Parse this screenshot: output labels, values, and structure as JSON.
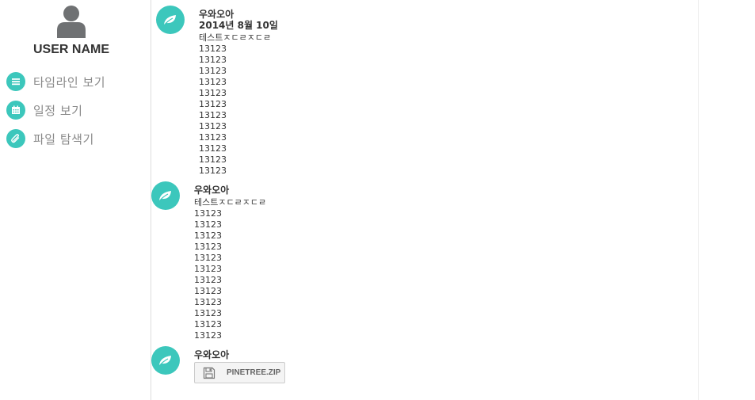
{
  "sidebar": {
    "user_name": "USER NAME",
    "items": [
      {
        "label": "타임라인 보기",
        "icon": "list-icon"
      },
      {
        "label": "일정 보기",
        "icon": "calendar-icon"
      },
      {
        "label": "파일 탐색기",
        "icon": "paperclip-icon"
      }
    ]
  },
  "accent_color": "#3cc7bc",
  "timeline": {
    "posts": [
      {
        "author": "우와오아",
        "date": "2014년 8월 10일",
        "lines": [
          "테스트ㅈㄷㄹㅈㄷㄹ",
          "13123",
          "13123",
          "13123",
          "13123",
          "13123",
          "13123",
          "13123",
          "13123",
          "13123",
          "13123",
          "13123",
          "13123"
        ]
      },
      {
        "author": "우와오아",
        "lines": [
          "테스트ㅈㄷㄹㅈㄷㄹ",
          "13123",
          "13123",
          "13123",
          "13123",
          "13123",
          "13123",
          "13123",
          "13123",
          "13123",
          "13123",
          "13123",
          "13123"
        ]
      },
      {
        "author": "우와오아",
        "file": {
          "name": "PINETREE.ZIP",
          "icon": "floppy-disk-icon"
        }
      }
    ]
  }
}
